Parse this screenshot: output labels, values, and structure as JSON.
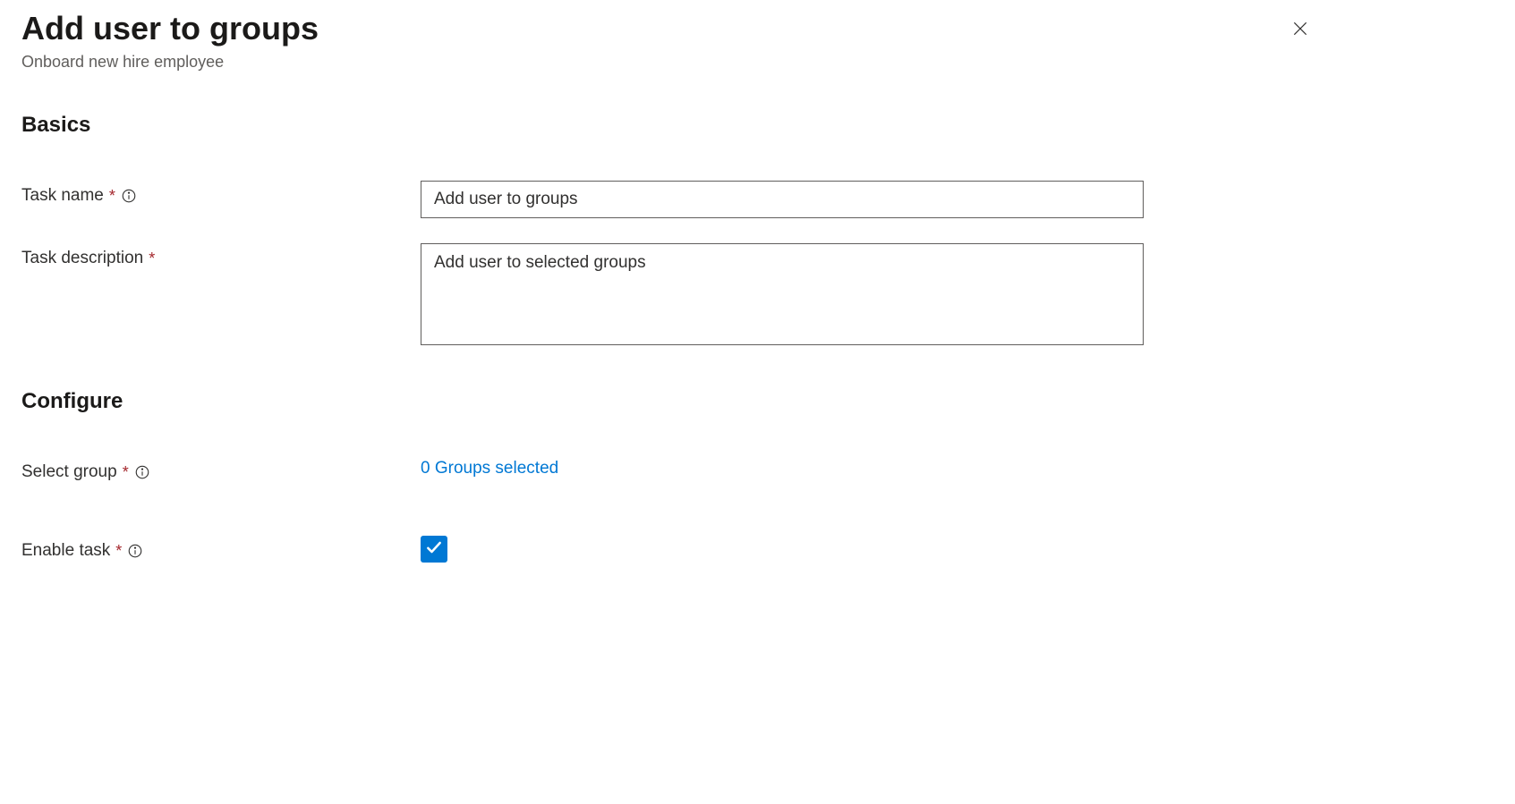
{
  "header": {
    "title": "Add user to groups",
    "subtitle": "Onboard new hire employee"
  },
  "sections": {
    "basics": "Basics",
    "configure": "Configure"
  },
  "fields": {
    "task_name": {
      "label": "Task name",
      "value": "Add user to groups"
    },
    "task_description": {
      "label": "Task description",
      "value": "Add user to selected groups"
    },
    "select_group": {
      "label": "Select group",
      "link_text": "0 Groups selected"
    },
    "enable_task": {
      "label": "Enable task",
      "checked": true
    }
  }
}
